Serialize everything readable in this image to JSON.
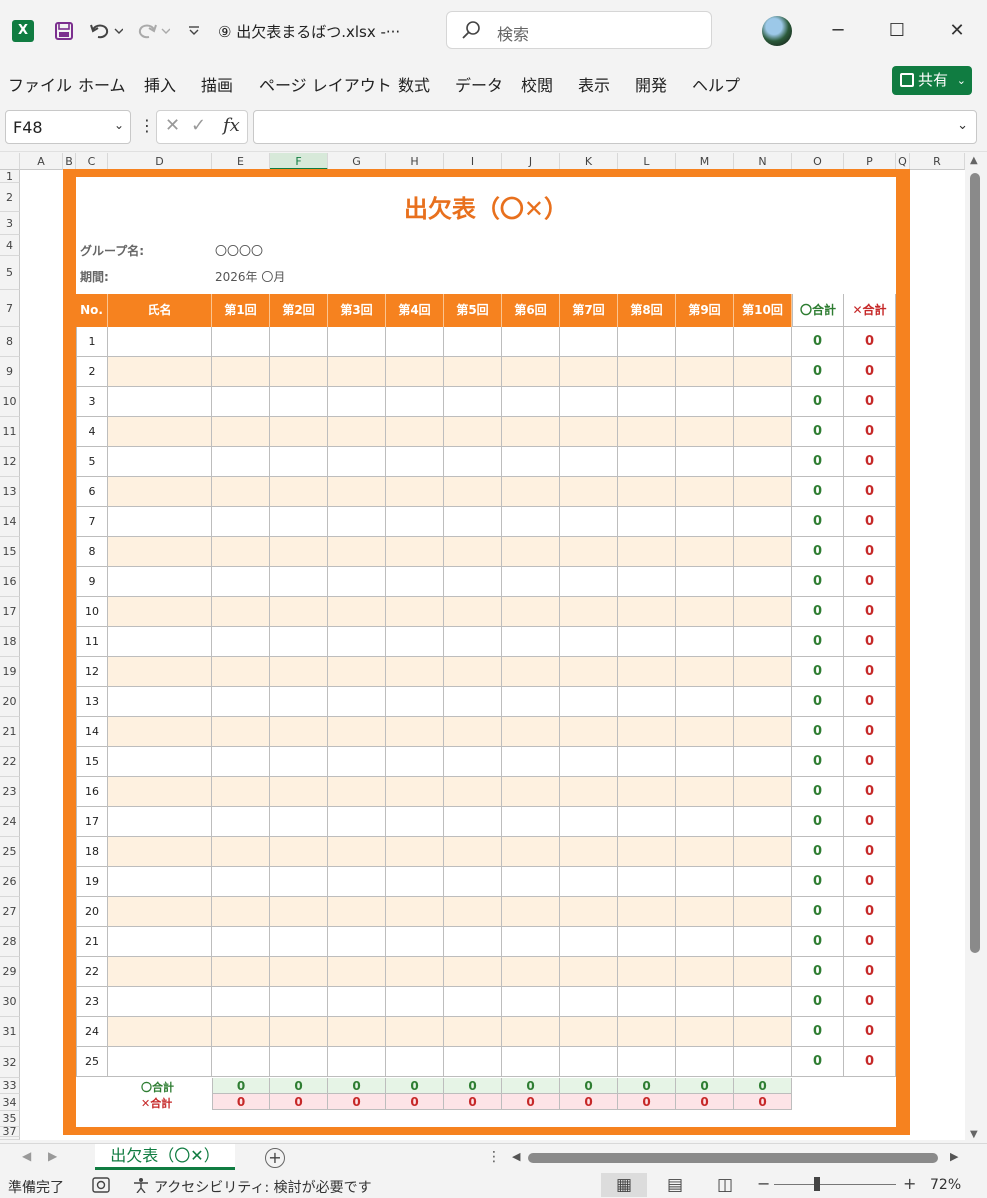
{
  "titlebar": {
    "app_icon_letter": "X",
    "document_title": "⑨ 出欠表まるばつ.xlsx  -···",
    "search_placeholder": "検索",
    "icons": [
      "excel-logo",
      "save-icon",
      "undo-icon",
      "redo-icon",
      "customize-icon",
      "search-icon",
      "avatar",
      "minimize-icon",
      "maximize-icon",
      "close-icon"
    ]
  },
  "menu": {
    "items": [
      "ファイル",
      "ホーム",
      "挿入",
      "描画",
      "ページ レイアウト",
      "数式",
      "データ",
      "校閲",
      "表示",
      "開発",
      "ヘルプ"
    ],
    "share_label": "共有"
  },
  "formula_bar": {
    "name_box": "F48",
    "formula_value": ""
  },
  "columns": [
    "A",
    "B",
    "C",
    "D",
    "E",
    "F",
    "G",
    "H",
    "I",
    "J",
    "K",
    "L",
    "M",
    "N",
    "O",
    "P",
    "Q",
    "R"
  ],
  "selected_column": "F",
  "rows": [
    "1",
    "2",
    "3",
    "4",
    "5",
    "7",
    "8",
    "9",
    "10",
    "11",
    "12",
    "13",
    "14",
    "15",
    "16",
    "17",
    "18",
    "19",
    "20",
    "21",
    "22",
    "23",
    "24",
    "25",
    "26",
    "27",
    "28",
    "29",
    "30",
    "31",
    "32",
    "33",
    "34",
    "35",
    "37"
  ],
  "sheet": {
    "title": "出欠表（〇✕）",
    "group_label": "グループ名:",
    "group_value": "〇〇〇〇",
    "period_label": "期間:",
    "period_value": "2026年 〇月",
    "header": {
      "no": "No.",
      "name": "氏名",
      "sessions": [
        "第1回",
        "第2回",
        "第3回",
        "第4回",
        "第5回",
        "第6回",
        "第7回",
        "第8回",
        "第9回",
        "第10回"
      ],
      "o_total": "〇合計",
      "x_total": "✕合計"
    },
    "entries": [
      {
        "no": "1",
        "o": "0",
        "x": "0"
      },
      {
        "no": "2",
        "o": "0",
        "x": "0"
      },
      {
        "no": "3",
        "o": "0",
        "x": "0"
      },
      {
        "no": "4",
        "o": "0",
        "x": "0"
      },
      {
        "no": "5",
        "o": "0",
        "x": "0"
      },
      {
        "no": "6",
        "o": "0",
        "x": "0"
      },
      {
        "no": "7",
        "o": "0",
        "x": "0"
      },
      {
        "no": "8",
        "o": "0",
        "x": "0"
      },
      {
        "no": "9",
        "o": "0",
        "x": "0"
      },
      {
        "no": "10",
        "o": "0",
        "x": "0"
      },
      {
        "no": "11",
        "o": "0",
        "x": "0"
      },
      {
        "no": "12",
        "o": "0",
        "x": "0"
      },
      {
        "no": "13",
        "o": "0",
        "x": "0"
      },
      {
        "no": "14",
        "o": "0",
        "x": "0"
      },
      {
        "no": "15",
        "o": "0",
        "x": "0"
      },
      {
        "no": "16",
        "o": "0",
        "x": "0"
      },
      {
        "no": "17",
        "o": "0",
        "x": "0"
      },
      {
        "no": "18",
        "o": "0",
        "x": "0"
      },
      {
        "no": "19",
        "o": "0",
        "x": "0"
      },
      {
        "no": "20",
        "o": "0",
        "x": "0"
      },
      {
        "no": "21",
        "o": "0",
        "x": "0"
      },
      {
        "no": "22",
        "o": "0",
        "x": "0"
      },
      {
        "no": "23",
        "o": "0",
        "x": "0"
      },
      {
        "no": "24",
        "o": "0",
        "x": "0"
      },
      {
        "no": "25",
        "o": "0",
        "x": "0"
      }
    ],
    "o_sum_label": "〇合計",
    "x_sum_label": "✕合計",
    "o_sums": [
      "0",
      "0",
      "0",
      "0",
      "0",
      "0",
      "0",
      "0",
      "0",
      "0"
    ],
    "x_sums": [
      "0",
      "0",
      "0",
      "0",
      "0",
      "0",
      "0",
      "0",
      "0",
      "0"
    ]
  },
  "tabs": {
    "sheets": [
      "出欠表（〇✕）"
    ],
    "active": "出欠表（〇✕）"
  },
  "status": {
    "ready": "準備完了",
    "accessibility": "アクセシビリティ: 検討が必要です",
    "zoom": "72%"
  },
  "colors": {
    "accent_orange": "#f6821f",
    "excel_green": "#107c41",
    "alt_row": "#fef1e0",
    "o_green": "#2e7d32",
    "x_red": "#c62828"
  }
}
